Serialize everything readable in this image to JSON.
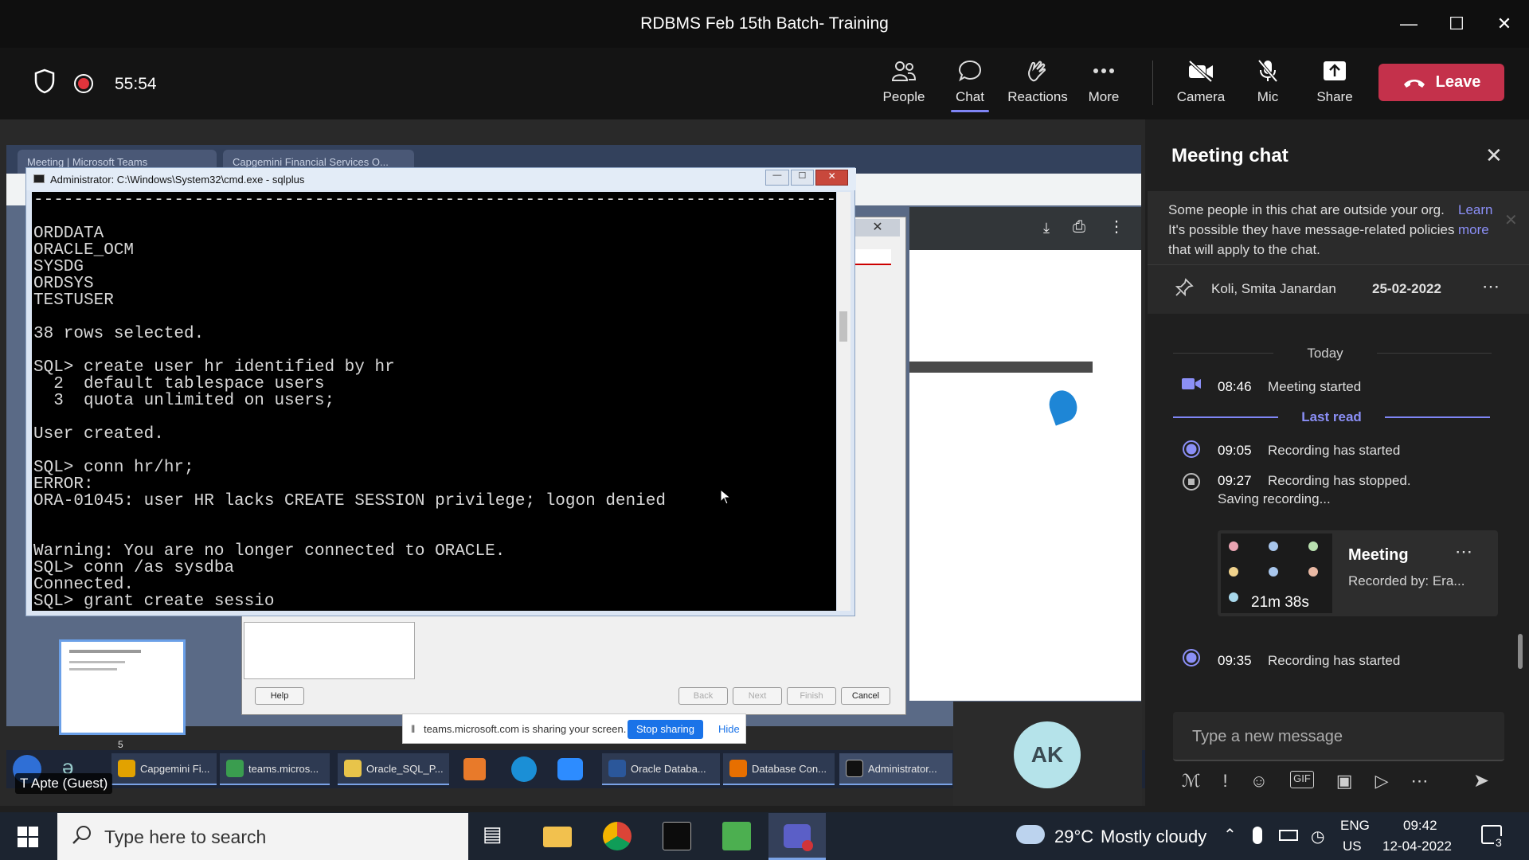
{
  "window": {
    "title": "RDBMS Feb 15th Batch- Training"
  },
  "meeting": {
    "timer": "55:54",
    "toolbar": {
      "people": "People",
      "chat": "Chat",
      "reactions": "Reactions",
      "more": "More",
      "camera": "Camera",
      "mic": "Mic",
      "share": "Share",
      "leave": "Leave"
    }
  },
  "shared_screen": {
    "browser_tabs": [
      "Meeting | Microsoft Teams",
      "Capgemini Financial Services O..."
    ],
    "cmd_title": "Administrator: C:\\Windows\\System32\\cmd.exe - sqlplus",
    "console_text": "--------------------------------------------------------------------------------\n\nORDDATA\nORACLE_OCM\nSYSDG\nORDSYS\nTESTUSER\n\n38 rows selected.\n\nSQL> create user hr identified by hr\n  2  default tablespace users\n  3  quota unlimited on users;\n\nUser created.\n\nSQL> conn hr/hr;\nERROR:\nORA-01045: user HR lacks CREATE SESSION privilege; logon denied\n\n\nWarning: You are no longer connected to ORACLE.\nSQL> conn /as sysdba\nConnected.\nSQL> grant create sessio",
    "wizard_buttons": {
      "help": "Help",
      "back": "Back",
      "next": "Next",
      "finish": "Finish",
      "cancel": "Cancel"
    },
    "slide_number": "5",
    "share_notice": "teams.microsoft.com is sharing your screen.",
    "stop_sharing": "Stop sharing",
    "hide": "Hide",
    "remote_taskbar": [
      "Capgemini Fi...",
      "teams.micros...",
      "Oracle_SQL_P...",
      "Oracle Databa...",
      "Database Con...",
      "Administrator..."
    ],
    "presenter_label": "T Apte (Guest)"
  },
  "participant_tile": {
    "initials": "AK"
  },
  "chat": {
    "title": "Meeting chat",
    "notice": "Some people in this chat are outside your org. It's possible they have message-related policies that will apply to the chat.",
    "learn_more": "Learn more",
    "pinned_name": "Koli, Smita Janardan",
    "pinned_date": "25-02-2022",
    "day_divider": "Today",
    "last_read": "Last read",
    "events": [
      {
        "time": "08:46",
        "text": "Meeting started"
      },
      {
        "time": "09:05",
        "text": "Recording has started"
      },
      {
        "time": "09:27",
        "text": "Recording has stopped.",
        "text2": "Saving recording..."
      },
      {
        "time": "09:35",
        "text": "Recording has started"
      }
    ],
    "recording_card": {
      "title": "Meeting",
      "subtitle": "Recorded by: Era...",
      "duration": "21m 38s"
    },
    "composer_placeholder": "Type a new message"
  },
  "taskbar": {
    "search_placeholder": "Type here to search",
    "weather_temp": "29°C",
    "weather_text": "Mostly cloudy",
    "lang_top": "ENG",
    "lang_bottom": "US",
    "time": "09:42",
    "date": "12-04-2022",
    "notification_count": "3"
  },
  "colors": {
    "leave": "#c4314b",
    "accent": "#7f85f5",
    "console_bg": "#000000"
  }
}
